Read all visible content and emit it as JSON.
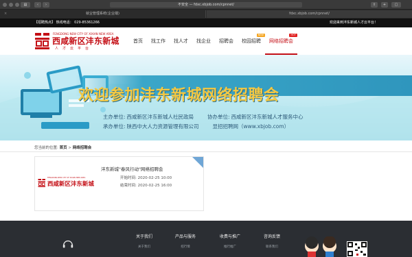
{
  "browser": {
    "url": "不安全 — fdxc.xbjob.com/cpnnet/",
    "tabs": [
      {
        "label": "就业管理系统(企业端)"
      },
      {
        "label": "fdxc.xbjob.com/cpnnet/"
      }
    ]
  },
  "topbar": {
    "left": "【招聘热点】 热线电话： 029-85361266",
    "right": "欢迎来到沣东新城人才云平台！"
  },
  "logo": {
    "en": "FENGDONG NEW CITY OF XIXIAN NEW AREA",
    "cn": "西咸新区沣东新城",
    "sub": "人才云平台"
  },
  "nav": {
    "items": [
      {
        "label": "首页"
      },
      {
        "label": "找工作"
      },
      {
        "label": "找人才"
      },
      {
        "label": "找企业"
      },
      {
        "label": "招聘会"
      },
      {
        "label": "校园招聘",
        "badge": "NEW"
      },
      {
        "label": "网络招聘会",
        "badge": "HOT",
        "active": true
      }
    ]
  },
  "banner": {
    "title": "欢迎参加沣东新城网络招聘会",
    "host_label": "主办单位:",
    "host": "西咸新区沣东新城人社民政局",
    "co_label": "协办单位:",
    "co": "西咸新区沣东新城人才服务中心",
    "org_label": "承办单位:",
    "org": "陕西中大人力资源管理有限公司",
    "site_label": "显招招聘网（www.xbjob.com）"
  },
  "breadcrumb": {
    "prefix": "您当前的位置:",
    "home": "首页",
    "sep": ">",
    "current": "网络招聘会"
  },
  "fair": {
    "title": "沣东新城\"春风行动\"网络招聘会",
    "start": "开始时间: 2020-02-25 10:00",
    "end": "结束时间: 2020-02-25 16:00"
  },
  "footer": {
    "cols": [
      {
        "heading": "关于我们",
        "item": "关于我们"
      },
      {
        "heading": "产品与服务",
        "item": "招行情"
      },
      {
        "heading": "收费与推广",
        "item": "推行推广"
      },
      {
        "heading": "咨询反馈",
        "item": "联系我们"
      }
    ]
  },
  "colors": {
    "brand_red": "#c40f16",
    "banner_gold": "#f4c842",
    "footer_bg": "#2b2e33"
  }
}
